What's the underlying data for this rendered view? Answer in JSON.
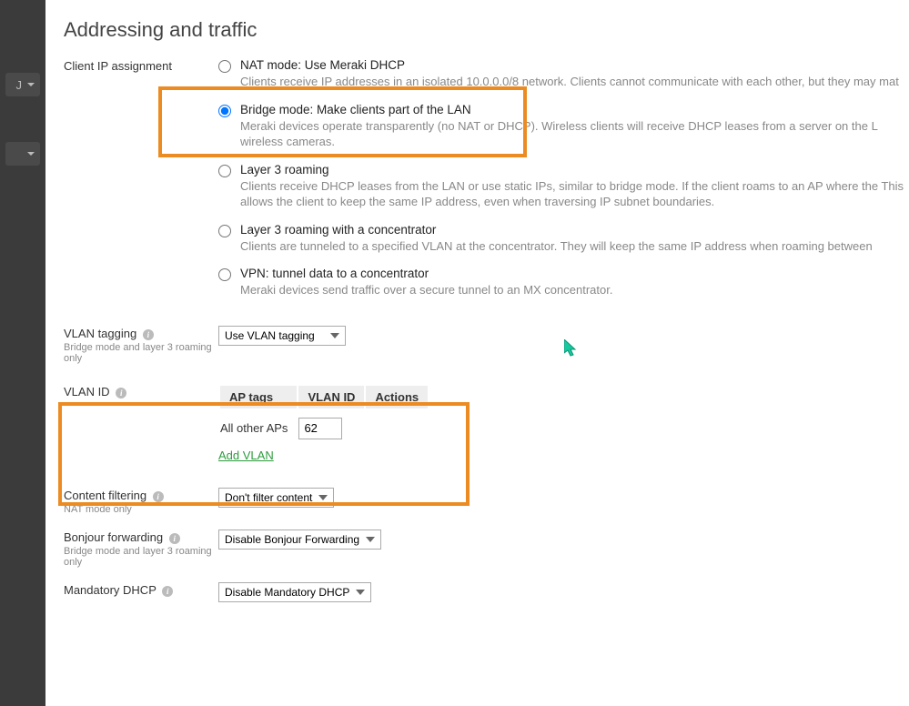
{
  "section_title": "Addressing and traffic",
  "ip_assignment": {
    "label": "Client IP assignment",
    "options": [
      {
        "title": "NAT mode: Use Meraki DHCP",
        "desc": "Clients receive IP addresses in an isolated 10.0.0.0/8 network. Clients cannot communicate with each other, but they may mat",
        "selected": false
      },
      {
        "title": "Bridge mode: Make clients part of the LAN",
        "desc": "Meraki devices operate transparently (no NAT or DHCP). Wireless clients will receive DHCP leases from a server on the L wireless cameras.",
        "selected": true
      },
      {
        "title": "Layer 3 roaming",
        "desc": "Clients receive DHCP leases from the LAN or use static IPs, similar to bridge mode. If the client roams to an AP where the This allows the client to keep the same IP address, even when traversing IP subnet boundaries.",
        "selected": false
      },
      {
        "title": "Layer 3 roaming with a concentrator",
        "desc": "Clients are tunneled to a specified VLAN at the concentrator. They will keep the same IP address when roaming between",
        "selected": false
      },
      {
        "title": "VPN: tunnel data to a concentrator",
        "desc": "Meraki devices send traffic over a secure tunnel to an MX concentrator.",
        "selected": false
      }
    ]
  },
  "vlan_tagging": {
    "label": "VLAN tagging",
    "sublabel": "Bridge mode and layer 3 roaming only",
    "value": "Use VLAN tagging"
  },
  "vlan_id": {
    "label": "VLAN ID",
    "headers": {
      "aptags": "AP tags",
      "vlanid": "VLAN ID",
      "actions": "Actions"
    },
    "row_label": "All other APs",
    "row_value": "62",
    "add_link": "Add VLAN"
  },
  "content_filtering": {
    "label": "Content filtering",
    "sublabel": "NAT mode only",
    "value": "Don't filter content"
  },
  "bonjour": {
    "label": "Bonjour forwarding",
    "sublabel": "Bridge mode and layer 3 roaming only",
    "value": "Disable Bonjour Forwarding"
  },
  "mandatory_dhcp": {
    "label": "Mandatory DHCP",
    "value": "Disable Mandatory DHCP"
  },
  "sidebar_letter": "J"
}
